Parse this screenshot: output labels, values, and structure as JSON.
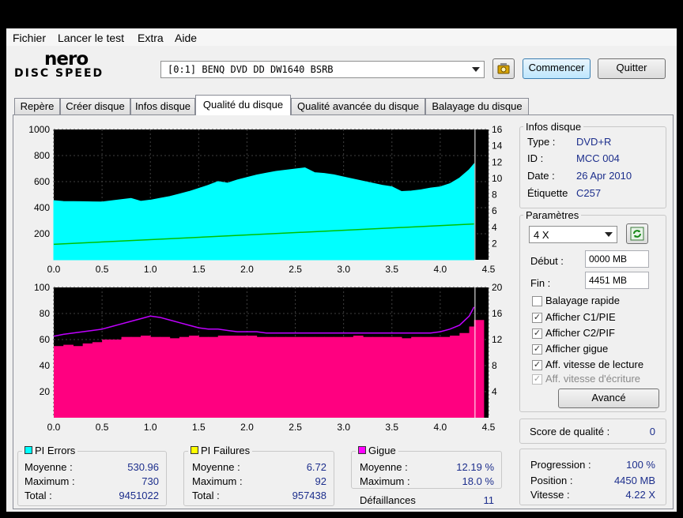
{
  "menu": [
    "Fichier",
    "Lancer le test",
    "Extra",
    "Aide"
  ],
  "logo": {
    "line1": "nero",
    "line2": "DISC SPEED"
  },
  "drive": {
    "selected": "[0:1]  BENQ DVD DD DW1640 BSRB"
  },
  "toolbar": {
    "start_label": "Commencer",
    "quit_label": "Quitter",
    "icon": "drive-settings-icon"
  },
  "tabs": [
    "Repère",
    "Créer disque",
    "Infos disque",
    "Qualité du disque",
    "Qualité avancée du disque",
    "Balayage du disque"
  ],
  "active_tab": 3,
  "disc_info": {
    "title": "Infos disque",
    "rows": [
      {
        "label": "Type :",
        "value": "DVD+R"
      },
      {
        "label": "ID :",
        "value": "MCC 004"
      },
      {
        "label": "Date :",
        "value": "26 Apr 2010"
      },
      {
        "label": "Étiquette",
        "value": "C257"
      }
    ]
  },
  "params": {
    "title": "Paramètres",
    "speed": "4 X",
    "start_label": "Début :",
    "start_value": "0000 MB",
    "end_label": "Fin :",
    "end_value": "4451 MB",
    "checks": [
      {
        "label": "Balayage rapide",
        "checked": false,
        "disabled": false
      },
      {
        "label": "Afficher C1/PIE",
        "checked": true,
        "disabled": false
      },
      {
        "label": "Afficher C2/PIF",
        "checked": true,
        "disabled": false
      },
      {
        "label": "Afficher gigue",
        "checked": true,
        "disabled": false
      },
      {
        "label": "Aff. vitesse de lecture",
        "checked": true,
        "disabled": false
      },
      {
        "label": "Aff. vitesse d'écriture",
        "checked": true,
        "disabled": true
      }
    ],
    "advanced_label": "Avancé"
  },
  "score": {
    "label": "Score de qualité :",
    "value": "0"
  },
  "progress": {
    "rows": [
      {
        "label": "Progression :",
        "value": "100 %"
      },
      {
        "label": "Position :",
        "value": "4450 MB"
      },
      {
        "label": "Vitesse :",
        "value": "4.22 X"
      }
    ]
  },
  "stats": {
    "pi_errors": {
      "title": "PI Errors",
      "color": "#00ffff",
      "avg_label": "Moyenne :",
      "avg": "530.96",
      "max_label": "Maximum :",
      "max": "730",
      "total_label": "Total :",
      "total": "9451022"
    },
    "pi_failures": {
      "title": "PI Failures",
      "color": "#ffff00",
      "avg_label": "Moyenne :",
      "avg": "6.72",
      "max_label": "Maximum :",
      "max": "92",
      "total_label": "Total :",
      "total": "957438"
    },
    "jitter": {
      "title": "Gigue",
      "color": "#ff00ff",
      "avg_label": "Moyenne :",
      "avg": "12.19 %",
      "max_label": "Maximum :",
      "max": "18.0 %"
    },
    "failures_label": "Défaillances",
    "failures_value": "11"
  },
  "chart_data": [
    {
      "type": "area",
      "x_ticks": [
        "0.0",
        "0.5",
        "1.0",
        "1.5",
        "2.0",
        "2.5",
        "3.0",
        "3.5",
        "4.0",
        "4.5"
      ],
      "xlim": [
        0,
        4.5
      ],
      "y_ticks": [
        "1000",
        "800",
        "600",
        "400",
        "200"
      ],
      "ylim": [
        0,
        1000
      ],
      "y2_ticks": [
        "16",
        "14",
        "12",
        "10",
        "8",
        "6",
        "4",
        "2"
      ],
      "y2lim": [
        0,
        16
      ],
      "grid": true,
      "series": [
        {
          "color": "#00ffff",
          "kind": "area",
          "x": [
            0,
            0.1,
            0.2,
            0.3,
            0.4,
            0.5,
            0.6,
            0.7,
            0.8,
            0.9,
            1.0,
            1.1,
            1.2,
            1.3,
            1.4,
            1.5,
            1.6,
            1.7,
            1.8,
            1.9,
            2.0,
            2.1,
            2.2,
            2.3,
            2.4,
            2.5,
            2.6,
            2.7,
            2.8,
            2.9,
            3.0,
            3.1,
            3.2,
            3.3,
            3.4,
            3.5,
            3.6,
            3.7,
            3.8,
            3.9,
            4.0,
            4.1,
            4.2,
            4.3,
            4.35
          ],
          "y": [
            470,
            460,
            455,
            450,
            445,
            440,
            445,
            450,
            455,
            465,
            470,
            480,
            490,
            505,
            520,
            540,
            560,
            585,
            605,
            625,
            640,
            655,
            665,
            675,
            680,
            685,
            690,
            685,
            675,
            660,
            640,
            620,
            600,
            580,
            560,
            545,
            540,
            540,
            545,
            555,
            560,
            580,
            620,
            680,
            720
          ]
        },
        {
          "color": "#00c000",
          "kind": "line",
          "axis": "right",
          "x": [
            0,
            4.35
          ],
          "y": [
            1.9,
            4.4
          ]
        }
      ]
    },
    {
      "type": "bar",
      "x_ticks": [
        "0.0",
        "0.5",
        "1.0",
        "1.5",
        "2.0",
        "2.5",
        "3.0",
        "3.5",
        "4.0",
        "4.5"
      ],
      "xlim": [
        0,
        4.5
      ],
      "y_ticks": [
        "100",
        "80",
        "60",
        "40",
        "20"
      ],
      "ylim": [
        0,
        100
      ],
      "y2_ticks": [
        "20",
        "16",
        "12",
        "8",
        "4"
      ],
      "y2lim": [
        0,
        20
      ],
      "grid": true,
      "series": [
        {
          "color": "#ff0080",
          "kind": "bars",
          "x": [
            0,
            0.1,
            0.2,
            0.3,
            0.4,
            0.5,
            0.6,
            0.7,
            0.8,
            0.9,
            1.0,
            1.1,
            1.2,
            1.3,
            1.4,
            1.5,
            1.6,
            1.7,
            1.8,
            1.9,
            2.0,
            2.1,
            2.2,
            2.3,
            2.4,
            2.5,
            2.6,
            2.7,
            2.8,
            2.9,
            3.0,
            3.1,
            3.2,
            3.3,
            3.4,
            3.5,
            3.6,
            3.7,
            3.8,
            3.9,
            4.0,
            4.1,
            4.2,
            4.3,
            4.35
          ],
          "y": [
            55,
            56,
            55,
            57,
            58,
            60,
            60,
            62,
            62,
            63,
            62,
            62,
            61,
            62,
            63,
            62,
            62,
            63,
            63,
            63,
            63,
            62,
            62,
            62,
            62,
            62,
            62,
            62,
            62,
            62,
            62,
            63,
            62,
            62,
            62,
            62,
            61,
            62,
            62,
            62,
            62,
            63,
            65,
            70,
            75
          ]
        },
        {
          "color": "#c000ff",
          "kind": "line",
          "axis": "right",
          "x": [
            0,
            0.1,
            0.2,
            0.3,
            0.4,
            0.5,
            0.6,
            0.7,
            0.8,
            0.9,
            1.0,
            1.1,
            1.2,
            1.3,
            1.4,
            1.5,
            1.6,
            1.7,
            1.8,
            1.9,
            2.0,
            2.1,
            2.2,
            2.3,
            2.4,
            2.5,
            2.6,
            2.7,
            2.8,
            2.9,
            3.0,
            3.1,
            3.2,
            3.3,
            3.4,
            3.5,
            3.6,
            3.7,
            3.8,
            3.9,
            4.0,
            4.1,
            4.2,
            4.3,
            4.35
          ],
          "y": [
            12.5,
            12.8,
            13,
            13.2,
            13.4,
            13.6,
            14,
            14.4,
            14.8,
            15.2,
            15.6,
            15.4,
            15,
            14.6,
            14.2,
            13.8,
            13.6,
            13.6,
            13.4,
            13.2,
            13.2,
            13.2,
            13,
            13,
            13,
            13,
            13,
            13,
            13,
            13,
            13,
            13,
            13,
            13,
            13,
            13,
            13,
            13,
            13,
            13,
            13.2,
            13.6,
            14.2,
            15.6,
            17
          ]
        }
      ]
    }
  ]
}
